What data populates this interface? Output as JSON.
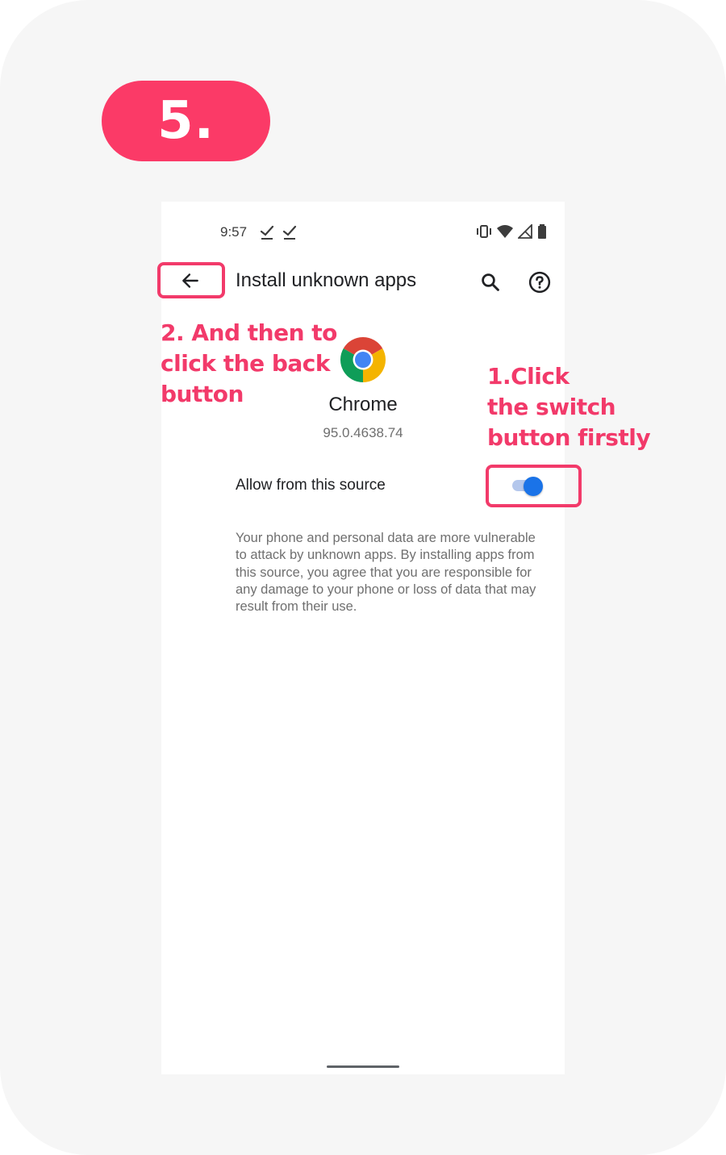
{
  "step": {
    "label": "5."
  },
  "status_bar": {
    "time": "9:57"
  },
  "app_bar": {
    "title": "Install unknown apps"
  },
  "app": {
    "name": "Chrome",
    "version": "95.0.4638.74"
  },
  "setting": {
    "label": "Allow from this source",
    "enabled": true
  },
  "warning": {
    "text": "Your phone and personal data are more vulnerable to attack by unknown apps. By installing apps from this source, you agree that you are responsible for any damage to your phone or loss of data that may result from their use."
  },
  "annotations": {
    "back": {
      "lines": [
        "2. And then to",
        "click the back",
        "button"
      ]
    },
    "switch": {
      "lines": [
        "1.Click",
        "the switch",
        "button firstly"
      ]
    }
  },
  "colors": {
    "accent": "#f23a6a",
    "badge": "#fb3a67",
    "toggle_on": "#1a73e8",
    "card_bg": "#f6f6f6"
  },
  "icons": {
    "back": "arrow-left-icon",
    "search": "search-icon",
    "help": "help-circle-icon",
    "app": "chrome-logo-icon",
    "vibrate": "vibrate-icon",
    "wifi": "wifi-icon",
    "signal": "signal-icon",
    "battery": "battery-icon",
    "check": "check-icon"
  }
}
